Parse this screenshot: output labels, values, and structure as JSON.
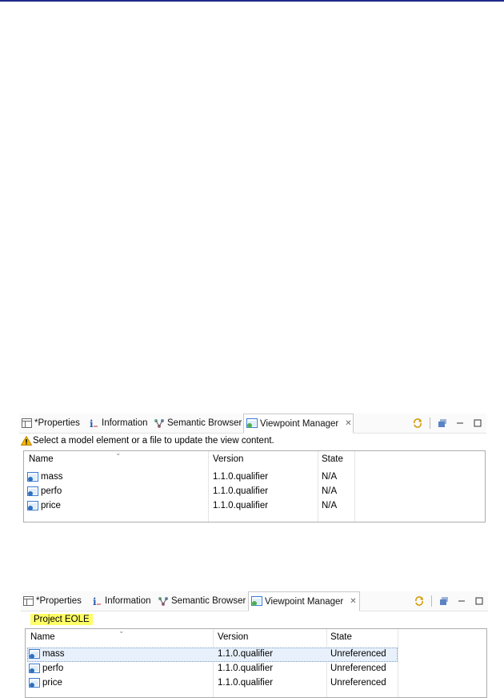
{
  "panels": [
    {
      "tabs": [
        {
          "label": "*Properties",
          "icon": "properties-icon"
        },
        {
          "label": "Information",
          "icon": "information-icon"
        },
        {
          "label": "Semantic Browser",
          "icon": "semantic-browser-icon"
        },
        {
          "label": "Viewpoint Manager",
          "icon": "viewpoint-manager-icon",
          "close": "✕"
        }
      ],
      "message": "Select a model element or a file to update the view content.",
      "columns": [
        "Name",
        "Version",
        "State"
      ],
      "rows": [
        {
          "name": "mass",
          "version": "1.1.0.qualifier",
          "state": "N/A"
        },
        {
          "name": "perfo",
          "version": "1.1.0.qualifier",
          "state": "N/A"
        },
        {
          "name": "price",
          "version": "1.1.0.qualifier",
          "state": "N/A"
        }
      ]
    },
    {
      "tabs": [
        {
          "label": "*Properties",
          "icon": "properties-icon"
        },
        {
          "label": "Information",
          "icon": "information-icon"
        },
        {
          "label": "Semantic Browser",
          "icon": "semantic-browser-icon"
        },
        {
          "label": "Viewpoint Manager",
          "icon": "viewpoint-manager-icon",
          "close": "✕"
        }
      ],
      "message": "Project EOLE",
      "columns": [
        "Name",
        "Version",
        "State"
      ],
      "rows": [
        {
          "name": "mass",
          "version": "1.1.0.qualifier",
          "state": "Unreferenced"
        },
        {
          "name": "perfo",
          "version": "1.1.0.qualifier",
          "state": "Unreferenced"
        },
        {
          "name": "price",
          "version": "1.1.0.qualifier",
          "state": "Unreferenced"
        }
      ]
    }
  ],
  "colors": {
    "highlight": "#ffff66",
    "warning": "#f5b800",
    "accent": "#1f2a8a"
  }
}
